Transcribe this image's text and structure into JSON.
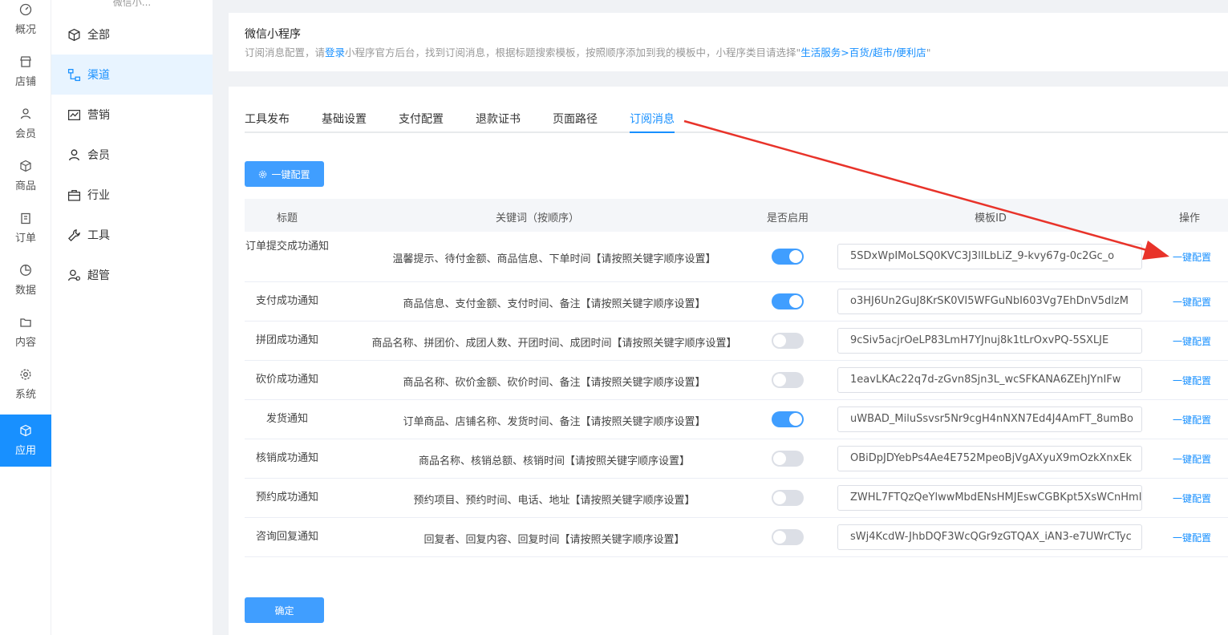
{
  "rail": {
    "items": [
      {
        "label": "概况",
        "icon": "dashboard-icon"
      },
      {
        "label": "店铺",
        "icon": "store-icon"
      },
      {
        "label": "会员",
        "icon": "user-icon"
      },
      {
        "label": "商品",
        "icon": "box-icon"
      },
      {
        "label": "订单",
        "icon": "clipboard-icon"
      },
      {
        "label": "数据",
        "icon": "pie-chart-icon"
      },
      {
        "label": "内容",
        "icon": "folder-icon"
      },
      {
        "label": "系统",
        "icon": "gear-icon"
      },
      {
        "label": "应用",
        "icon": "cube-icon"
      }
    ],
    "active_index": 8
  },
  "submenu": {
    "top_label": "微信小...",
    "items": [
      {
        "label": "全部",
        "icon": "cube-icon"
      },
      {
        "label": "渠道",
        "icon": "sitemap-icon"
      },
      {
        "label": "营销",
        "icon": "chart-line-icon"
      },
      {
        "label": "会员",
        "icon": "user-icon"
      },
      {
        "label": "行业",
        "icon": "briefcase-icon"
      },
      {
        "label": "工具",
        "icon": "wrench-icon"
      },
      {
        "label": "超管",
        "icon": "admin-icon"
      }
    ],
    "active_index": 1
  },
  "header": {
    "title": "微信小程序",
    "desc_pre": "订阅消息配置，请",
    "desc_link": "登录",
    "desc_mid": "小程序官方后台，找到订阅消息，根据标题搜索模板，按照顺序添加到我的模板中，小程序类目请选择\"",
    "desc_category": "生活服务>百货/超市/便利店",
    "desc_end": "\""
  },
  "tabs": {
    "items": [
      "工具发布",
      "基础设置",
      "支付配置",
      "退款证书",
      "页面路径",
      "订阅消息"
    ],
    "active_index": 5
  },
  "actions": {
    "onekey_label": "一键配置",
    "confirm_label": "确定"
  },
  "table": {
    "headers": [
      "标题",
      "关键词（按顺序）",
      "是否启用",
      "模板ID",
      "操作"
    ],
    "rows": [
      {
        "title": "订单提交成功通知",
        "keywords": "温馨提示、待付金额、商品信息、下单时间【请按照关键字顺序设置】",
        "enabled": true,
        "template_id": "5SDxWpIMoLSQ0KVC3J3lILbLiZ_9-kvy67g-0c2Gc_o",
        "op": "一键配置"
      },
      {
        "title": "支付成功通知",
        "keywords": "商品信息、支付金额、支付时间、备注【请按照关键字顺序设置】",
        "enabled": true,
        "template_id": "o3HJ6Un2GuJ8KrSK0VI5WFGuNbI603Vg7EhDnV5dlzM",
        "op": "一键配置"
      },
      {
        "title": "拼团成功通知",
        "keywords": "商品名称、拼团价、成团人数、开团时间、成团时间【请按照关键字顺序设置】",
        "enabled": false,
        "template_id": "9cSiv5acjrOeLP83LmH7YJnuj8k1tLrOxvPQ-5SXLJE",
        "op": "一键配置"
      },
      {
        "title": "砍价成功通知",
        "keywords": "商品名称、砍价金额、砍价时间、备注【请按照关键字顺序设置】",
        "enabled": false,
        "template_id": "1eavLKAc22q7d-zGvn8Sjn3L_wcSFKANA6ZEhJYnIFw",
        "op": "一键配置"
      },
      {
        "title": "发货通知",
        "keywords": "订单商品、店铺名称、发货时间、备注【请按照关键字顺序设置】",
        "enabled": true,
        "template_id": "uWBAD_MiluSsvsr5Nr9cgH4nNXN7Ed4J4AmFT_8umBo",
        "op": "一键配置"
      },
      {
        "title": "核销成功通知",
        "keywords": "商品名称、核销总额、核销时间【请按照关键字顺序设置】",
        "enabled": false,
        "template_id": "OBiDpJDYebPs4Ae4E752MpeoBjVgAXyuX9mOzkXnxEk",
        "op": "一键配置"
      },
      {
        "title": "预约成功通知",
        "keywords": "预约项目、预约时间、电话、地址【请按照关键字顺序设置】",
        "enabled": false,
        "template_id": "ZWHL7FTQzQeYlwwMbdENsHMJEswCGBKpt5XsWCnHml",
        "op": "一键配置"
      },
      {
        "title": "咨询回复通知",
        "keywords": "回复者、回复内容、回复时间【请按照关键字顺序设置】",
        "enabled": false,
        "template_id": "sWj4KcdW-JhbDQF3WcQGr9zGTQAX_iAN3-e7UWrCTyc",
        "op": "一键配置"
      }
    ]
  },
  "colors": {
    "primary": "#409eff",
    "link": "#1890ff",
    "annotation_arrow": "#e8332a"
  }
}
